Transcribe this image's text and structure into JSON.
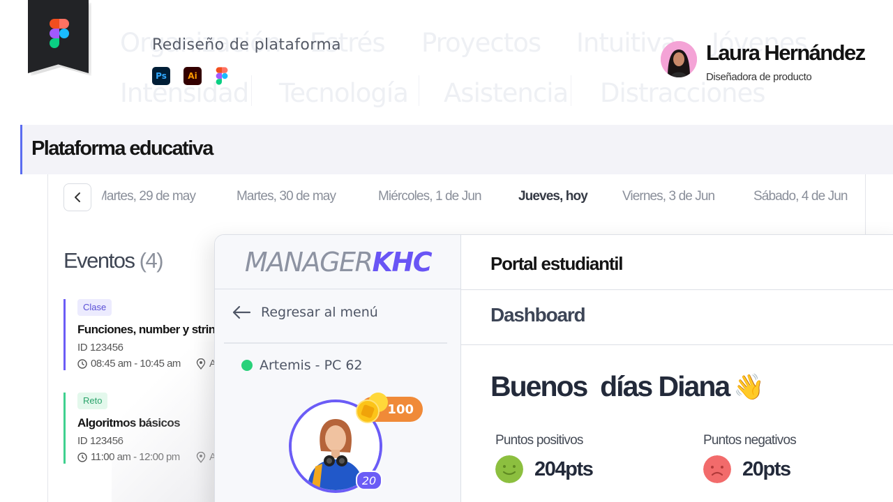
{
  "header": {
    "background_words": [
      "Organización",
      "Estrés",
      "Proyectos",
      "Intuitiva",
      "Jóvenes",
      "Intensidad",
      "Tecnología",
      "Asistencia",
      "Distracciones"
    ],
    "project_title": "Rediseño de plataforma",
    "tools": [
      {
        "name": "photoshop-icon",
        "label": "Ps"
      },
      {
        "name": "illustrator-icon",
        "label": "Ai"
      },
      {
        "name": "figma-icon",
        "label": ""
      }
    ],
    "author": {
      "name": "Laura Hernández",
      "role": "Diseñadora de producto"
    }
  },
  "section": {
    "title": "Plataforma educativa"
  },
  "calendar": {
    "dates": [
      "Martes, 29 de may",
      "Martes, 30 de may",
      "Miércoles, 1 de Jun",
      "Jueves, hoy",
      "Viernes, 3 de Jun",
      "Sábado, 4 de Jun"
    ],
    "active_index": 3
  },
  "events": {
    "title": "Eventos",
    "count": "(4)",
    "items": [
      {
        "tag": "Clase",
        "name": "Funciones, number y strings",
        "id": "ID 123456",
        "time": "08:45 am - 10:45 am",
        "location": "A",
        "color": "#6b5cf6",
        "tag_bg": "#ecebfe",
        "tag_color": "#5a4fd6"
      },
      {
        "tag": "Reto",
        "name": "Algoritmos básicos",
        "id": "ID 123456",
        "time": "11:00 am - 12:00 pm",
        "location": "A",
        "color": "#3fd18f",
        "tag_bg": "#e3f8ec",
        "tag_color": "#2ba36b"
      }
    ]
  },
  "app": {
    "logo_part1": "MANAGER",
    "logo_part2": "KHC",
    "back_to_menu": "Regresar al menú",
    "station": "Artemis - PC 62",
    "coins": "100",
    "level": "20",
    "portal_title": "Portal estudiantil",
    "dashboard_label": "Dashboard",
    "greeting": "Buenos  días Diana",
    "greeting_emoji": "👋",
    "positive_label": "Puntos positivos",
    "positive_value": "204pts",
    "negative_label": "Puntos negativos",
    "negative_value": "20pts"
  },
  "colors": {
    "accent": "#6b5cf6",
    "section_bar": "#5a6cf0",
    "coins": "#f08a38",
    "online": "#29d17a",
    "positive": "#8cbf3f",
    "negative": "#f26b6b"
  }
}
